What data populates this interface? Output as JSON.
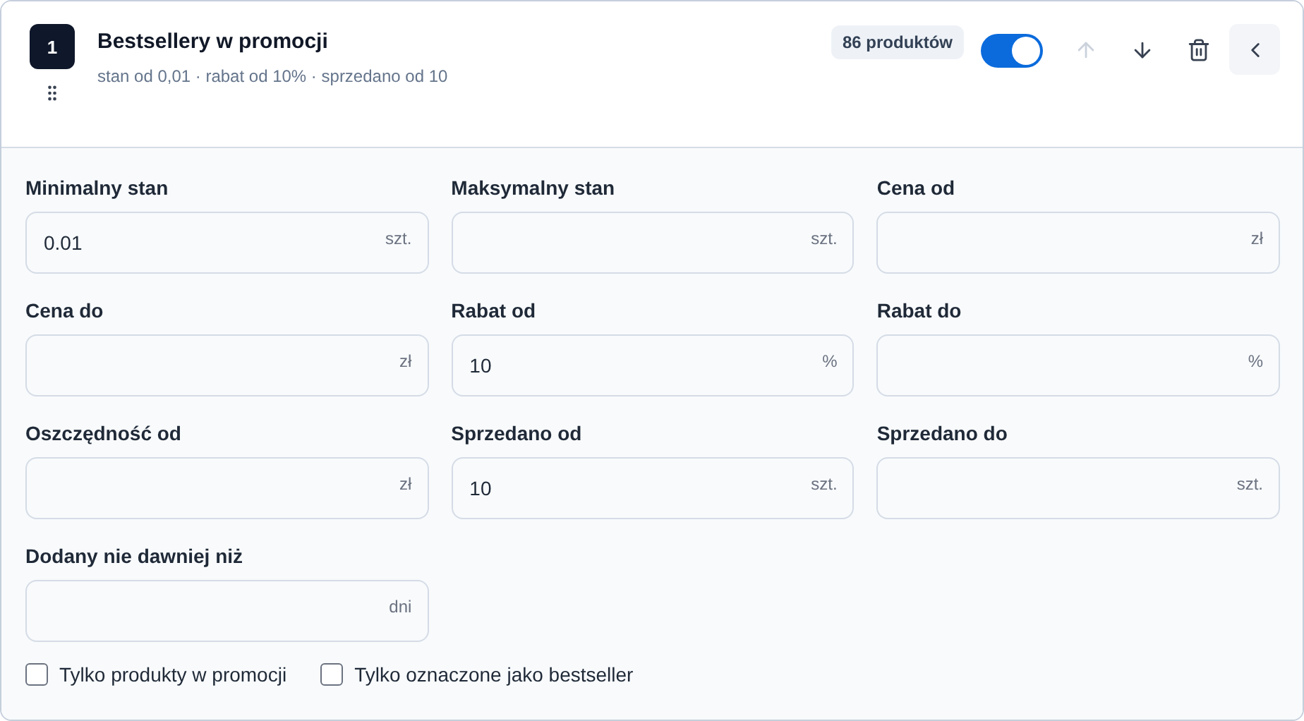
{
  "rule": {
    "number": "1",
    "title": "Bestsellery w promocji",
    "summary": "stan od 0,01 · rabat od 10% · sprzedano od 10",
    "count": "86 produktów",
    "enabled": true,
    "actions": [
      {
        "kind": "up",
        "disabled": true
      },
      {
        "kind": "down",
        "disabled": false
      },
      {
        "kind": "delete",
        "disabled": false
      },
      {
        "kind": "collapse",
        "disabled": false
      }
    ]
  },
  "fields": [
    {
      "label": "Minimalny stan",
      "value": "0.01",
      "unit": "szt."
    },
    {
      "label": "Maksymalny stan",
      "unit": "szt."
    },
    {
      "label": "Cena od",
      "unit": "zł"
    },
    {
      "label": "Cena do",
      "unit": "zł"
    },
    {
      "label": "Rabat od",
      "value": "10",
      "unit": "%"
    },
    {
      "label": "Rabat do",
      "unit": "%"
    },
    {
      "label": "Oszczędność od",
      "unit": "zł"
    },
    {
      "label": "Sprzedano od",
      "value": "10",
      "unit": "szt."
    },
    {
      "label": "Sprzedano do",
      "unit": "szt."
    },
    {
      "label": "Dodany nie dawniej niż",
      "unit": "dni"
    }
  ],
  "checkboxes": [
    {
      "label": "Tylko produkty w promocji",
      "checked": false
    },
    {
      "label": "Tylko oznaczone jako bestseller",
      "checked": false
    }
  ]
}
